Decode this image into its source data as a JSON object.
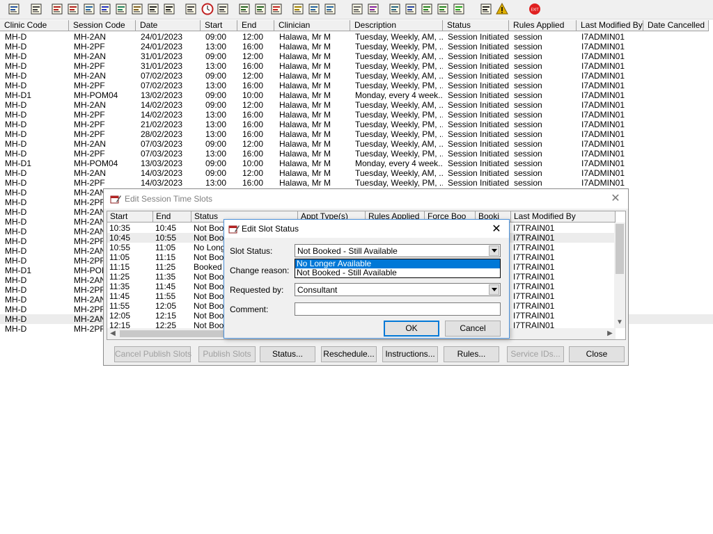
{
  "toolbar": {
    "icons": [
      "patient-icon",
      "print-icon",
      "book-icon",
      "book-edit-icon",
      "grid-icon",
      "m-icon",
      "person-icon",
      "edit-doc-icon",
      "flag-icon",
      "flag-alt-icon",
      "search-doc-icon",
      "clock-icon",
      "list-icon",
      "report-icon",
      "report-edit-icon",
      "chart-icon",
      "note-icon",
      "car-icon",
      "transfer-icon",
      "page-icon",
      "bar-chart-icon",
      "world-icon",
      "check-list-icon",
      "check-doc-icon",
      "refresh-icon",
      "green-arrows-icon",
      "swap-icon",
      "warning-icon",
      "exit-icon"
    ]
  },
  "main_grid": {
    "columns": [
      "Clinic Code",
      "Session Code",
      "Date",
      "Start",
      "End",
      "Clinician",
      "Description",
      "Status",
      "Rules Applied",
      "Last Modified By",
      "Date Cancelled"
    ],
    "rows": [
      [
        "MH-D",
        "MH-2AN",
        "24/01/2023",
        "09:00",
        "12:00",
        "Halawa, Mr M",
        "Tuesday, Weekly, AM, ...",
        "Session Initiated",
        "session",
        "I7ADMIN01",
        ""
      ],
      [
        "MH-D",
        "MH-2PF",
        "24/01/2023",
        "13:00",
        "16:00",
        "Halawa, Mr M",
        "Tuesday, Weekly, PM, ...",
        "Session Initiated",
        "session",
        "I7ADMIN01",
        ""
      ],
      [
        "MH-D",
        "MH-2AN",
        "31/01/2023",
        "09:00",
        "12:00",
        "Halawa, Mr M",
        "Tuesday, Weekly, AM, ...",
        "Session Initiated",
        "session",
        "I7ADMIN01",
        ""
      ],
      [
        "MH-D",
        "MH-2PF",
        "31/01/2023",
        "13:00",
        "16:00",
        "Halawa, Mr M",
        "Tuesday, Weekly, PM, ...",
        "Session Initiated",
        "session",
        "I7ADMIN01",
        ""
      ],
      [
        "MH-D",
        "MH-2AN",
        "07/02/2023",
        "09:00",
        "12:00",
        "Halawa, Mr M",
        "Tuesday, Weekly, AM, ...",
        "Session Initiated",
        "session",
        "I7ADMIN01",
        ""
      ],
      [
        "MH-D",
        "MH-2PF",
        "07/02/2023",
        "13:00",
        "16:00",
        "Halawa, Mr M",
        "Tuesday, Weekly, PM, ...",
        "Session Initiated",
        "session",
        "I7ADMIN01",
        ""
      ],
      [
        "MH-D1",
        "MH-POM04",
        "13/02/2023",
        "09:00",
        "10:00",
        "Halawa, Mr M",
        "Monday, every 4 week...",
        "Session Initiated",
        "session",
        "I7ADMIN01",
        ""
      ],
      [
        "MH-D",
        "MH-2AN",
        "14/02/2023",
        "09:00",
        "12:00",
        "Halawa, Mr M",
        "Tuesday, Weekly, AM, ...",
        "Session Initiated",
        "session",
        "I7ADMIN01",
        ""
      ],
      [
        "MH-D",
        "MH-2PF",
        "14/02/2023",
        "13:00",
        "16:00",
        "Halawa, Mr M",
        "Tuesday, Weekly, PM, ...",
        "Session Initiated",
        "session",
        "I7ADMIN01",
        ""
      ],
      [
        "MH-D",
        "MH-2PF",
        "21/02/2023",
        "13:00",
        "16:00",
        "Halawa, Mr M",
        "Tuesday, Weekly, PM, ...",
        "Session Initiated",
        "session",
        "I7ADMIN01",
        ""
      ],
      [
        "MH-D",
        "MH-2PF",
        "28/02/2023",
        "13:00",
        "16:00",
        "Halawa, Mr M",
        "Tuesday, Weekly, PM, ...",
        "Session Initiated",
        "session",
        "I7ADMIN01",
        ""
      ],
      [
        "MH-D",
        "MH-2AN",
        "07/03/2023",
        "09:00",
        "12:00",
        "Halawa, Mr M",
        "Tuesday, Weekly, AM, ...",
        "Session Initiated",
        "session",
        "I7ADMIN01",
        ""
      ],
      [
        "MH-D",
        "MH-2PF",
        "07/03/2023",
        "13:00",
        "16:00",
        "Halawa, Mr M",
        "Tuesday, Weekly, PM, ...",
        "Session Initiated",
        "session",
        "I7ADMIN01",
        ""
      ],
      [
        "MH-D1",
        "MH-POM04",
        "13/03/2023",
        "09:00",
        "10:00",
        "Halawa, Mr M",
        "Monday, every 4 week...",
        "Session Initiated",
        "session",
        "I7ADMIN01",
        ""
      ],
      [
        "MH-D",
        "MH-2AN",
        "14/03/2023",
        "09:00",
        "12:00",
        "Halawa, Mr M",
        "Tuesday, Weekly, AM, ...",
        "Session Initiated",
        "session",
        "I7ADMIN01",
        ""
      ],
      [
        "MH-D",
        "MH-2PF",
        "14/03/2023",
        "13:00",
        "16:00",
        "Halawa, Mr M",
        "Tuesday, Weekly, PM, ...",
        "Session Initiated",
        "session",
        "I7ADMIN01",
        ""
      ],
      [
        "MH-D",
        "MH-2AN",
        "",
        "",
        "",
        "",
        "",
        "",
        "",
        "",
        ""
      ],
      [
        "MH-D",
        "MH-2PF",
        "",
        "",
        "",
        "",
        "",
        "",
        "",
        "",
        ""
      ],
      [
        "MH-D",
        "MH-2AN",
        "",
        "",
        "",
        "",
        "",
        "",
        "",
        "",
        ""
      ],
      [
        "MH-D",
        "MH-2AN",
        "",
        "",
        "",
        "",
        "",
        "",
        "",
        "",
        ""
      ],
      [
        "MH-D",
        "MH-2AN",
        "",
        "",
        "",
        "",
        "",
        "",
        "",
        "",
        ""
      ],
      [
        "MH-D",
        "MH-2PF",
        "",
        "",
        "",
        "",
        "",
        "",
        "",
        "",
        ""
      ],
      [
        "MH-D",
        "MH-2AN",
        "",
        "",
        "",
        "",
        "",
        "",
        "",
        "",
        ""
      ],
      [
        "MH-D",
        "MH-2PF",
        "",
        "",
        "",
        "",
        "",
        "",
        "",
        "",
        ""
      ],
      [
        "MH-D1",
        "MH-POM",
        "",
        "",
        "",
        "",
        "",
        "",
        "",
        "",
        ""
      ],
      [
        "MH-D",
        "MH-2AN",
        "",
        "",
        "",
        "",
        "",
        "",
        "",
        "",
        ""
      ],
      [
        "MH-D",
        "MH-2PF",
        "",
        "",
        "",
        "",
        "",
        "",
        "",
        "",
        ""
      ],
      [
        "MH-D",
        "MH-2AN",
        "",
        "",
        "",
        "",
        "",
        "",
        "",
        "",
        ""
      ],
      [
        "MH-D",
        "MH-2PF",
        "",
        "",
        "",
        "",
        "",
        "",
        "",
        "",
        ""
      ],
      [
        "MH-D",
        "MH-2AN",
        "",
        "",
        "",
        "",
        "",
        "",
        "",
        "",
        ""
      ],
      [
        "MH-D",
        "MH-2PF",
        "",
        "",
        "",
        "",
        "",
        "",
        "",
        "",
        ""
      ]
    ],
    "highlighted_row": 29
  },
  "session_dialog": {
    "title": "Edit Session Time Slots",
    "columns": [
      "Start",
      "End",
      "Status",
      "Appt Type(s)",
      "Rules Applied",
      "Force Boo",
      "Booki",
      "Last Modified By"
    ],
    "rows": [
      [
        "10:35",
        "10:45",
        "Not Book",
        "I7TRAIN01"
      ],
      [
        "10:45",
        "10:55",
        "Not Book",
        "I7TRAIN01"
      ],
      [
        "10:55",
        "11:05",
        "No Longe",
        "I7TRAIN01"
      ],
      [
        "11:05",
        "11:15",
        "Not Book",
        "I7TRAIN01"
      ],
      [
        "11:15",
        "11:25",
        "Booked",
        "I7TRAIN01"
      ],
      [
        "11:25",
        "11:35",
        "Not Book",
        "I7TRAIN01"
      ],
      [
        "11:35",
        "11:45",
        "Not Book",
        "I7TRAIN01"
      ],
      [
        "11:45",
        "11:55",
        "Not Book",
        "I7TRAIN01"
      ],
      [
        "11:55",
        "12:05",
        "Not Book",
        "I7TRAIN01"
      ],
      [
        "12:05",
        "12:15",
        "Not Book",
        "I7TRAIN01"
      ],
      [
        "12:15",
        "12:25",
        "Not Book",
        "I7TRAIN01"
      ]
    ],
    "highlighted_row": 1,
    "buttons": {
      "cancel_publish": "Cancel Publish Slots",
      "publish": "Publish Slots",
      "status": "Status...",
      "reschedule": "Reschedule...",
      "instructions": "Instructions...",
      "rules": "Rules...",
      "service_ids": "Service IDs...",
      "close": "Close"
    }
  },
  "status_dialog": {
    "title": "Edit Slot Status",
    "slot_status_label": "Slot Status:",
    "slot_status_value": "Not Booked - Still Available",
    "slot_status_options": [
      "No Longer Available",
      "Not Booked - Still Available"
    ],
    "highlighted_option": 0,
    "change_reason_label": "Change reason:",
    "requested_by_label": "Requested by:",
    "requested_by_value": "Consultant",
    "comment_label": "Comment:",
    "comment_value": "",
    "ok_label": "OK",
    "cancel_label": "Cancel"
  }
}
